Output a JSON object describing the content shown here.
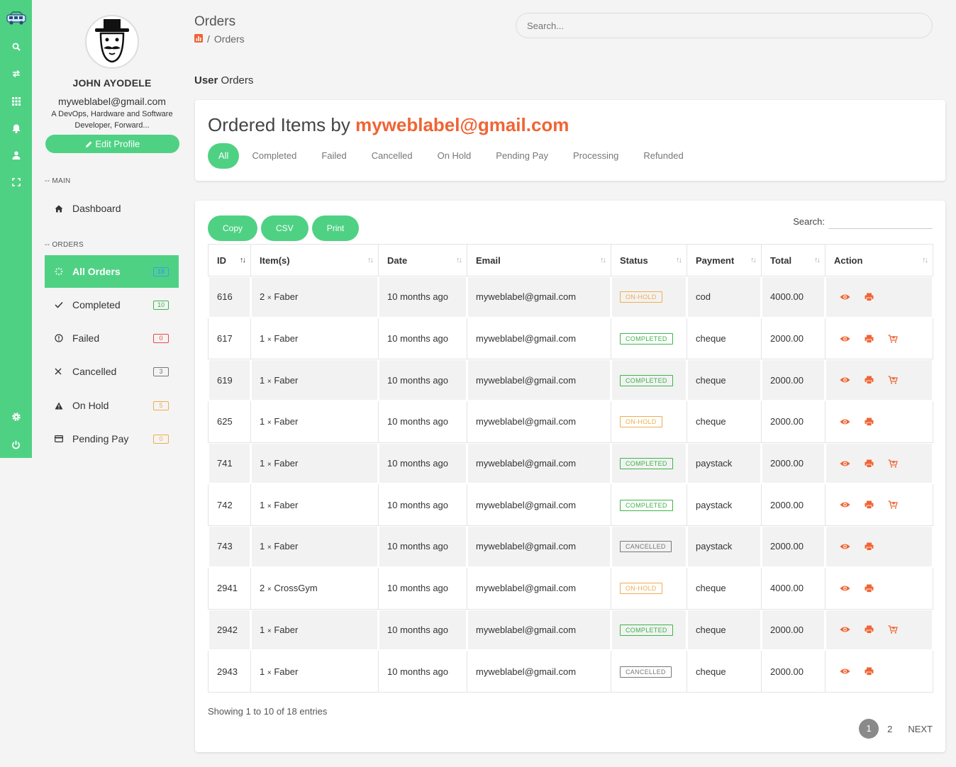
{
  "profile": {
    "name": "JOHN AYODELE",
    "email": "myweblabel@gmail.com",
    "bio": "A DevOps, Hardware and Software Developer, Forward...",
    "edit_label": "Edit Profile"
  },
  "sidebar": {
    "main_section": "-- MAIN",
    "orders_section": "-- ORDERS",
    "dashboard_label": "Dashboard",
    "items": [
      {
        "label": "All Orders",
        "count": "18",
        "color": "#3aa0e8"
      },
      {
        "label": "Completed",
        "count": "10",
        "color": "#3cb54a"
      },
      {
        "label": "Failed",
        "count": "0",
        "color": "#e84a4a"
      },
      {
        "label": "Cancelled",
        "count": "3",
        "color": "#777777"
      },
      {
        "label": "On Hold",
        "count": "5",
        "color": "#f0ad4e"
      },
      {
        "label": "Pending Pay",
        "count": "0",
        "color": "#f0ad4e"
      }
    ]
  },
  "header": {
    "title": "Orders",
    "breadcrumb_current": "Orders",
    "search_placeholder": "Search..."
  },
  "subheading": {
    "bold": "User",
    "rest": "Orders"
  },
  "filter_card": {
    "title_prefix": "Ordered Items by",
    "title_email": "myweblabel@gmail.com",
    "tabs": [
      "All",
      "Completed",
      "Failed",
      "Cancelled",
      "On Hold",
      "Pending Pay",
      "Processing",
      "Refunded"
    ]
  },
  "table_toolbar": {
    "buttons": [
      "Copy",
      "CSV",
      "Print"
    ],
    "search_label": "Search:"
  },
  "table": {
    "headers": [
      "ID",
      "Item(s)",
      "Date",
      "Email",
      "Status",
      "Payment",
      "Total",
      "Action"
    ],
    "rows": [
      {
        "id": "616",
        "qty": "2",
        "times": "×",
        "item": "Faber",
        "date": "10 months ago",
        "email": "myweblabel@gmail.com",
        "status": "ON-HOLD",
        "payment": "cod",
        "total": "4000.00"
      },
      {
        "id": "617",
        "qty": "1",
        "times": "×",
        "item": "Faber",
        "date": "10 months ago",
        "email": "myweblabel@gmail.com",
        "status": "COMPLETED",
        "payment": "cheque",
        "total": "2000.00"
      },
      {
        "id": "619",
        "qty": "1",
        "times": "×",
        "item": "Faber",
        "date": "10 months ago",
        "email": "myweblabel@gmail.com",
        "status": "COMPLETED",
        "payment": "cheque",
        "total": "2000.00"
      },
      {
        "id": "625",
        "qty": "1",
        "times": "×",
        "item": "Faber",
        "date": "10 months ago",
        "email": "myweblabel@gmail.com",
        "status": "ON-HOLD",
        "payment": "cheque",
        "total": "2000.00"
      },
      {
        "id": "741",
        "qty": "1",
        "times": "×",
        "item": "Faber",
        "date": "10 months ago",
        "email": "myweblabel@gmail.com",
        "status": "COMPLETED",
        "payment": "paystack",
        "total": "2000.00"
      },
      {
        "id": "742",
        "qty": "1",
        "times": "×",
        "item": "Faber",
        "date": "10 months ago",
        "email": "myweblabel@gmail.com",
        "status": "COMPLETED",
        "payment": "paystack",
        "total": "2000.00"
      },
      {
        "id": "743",
        "qty": "1",
        "times": "×",
        "item": "Faber",
        "date": "10 months ago",
        "email": "myweblabel@gmail.com",
        "status": "CANCELLED",
        "payment": "paystack",
        "total": "2000.00"
      },
      {
        "id": "2941",
        "qty": "2",
        "times": "×",
        "item": "CrossGym",
        "date": "10 months ago",
        "email": "myweblabel@gmail.com",
        "status": "ON-HOLD",
        "payment": "cheque",
        "total": "4000.00"
      },
      {
        "id": "2942",
        "qty": "1",
        "times": "×",
        "item": "Faber",
        "date": "10 months ago",
        "email": "myweblabel@gmail.com",
        "status": "COMPLETED",
        "payment": "cheque",
        "total": "2000.00"
      },
      {
        "id": "2943",
        "qty": "1",
        "times": "×",
        "item": "Faber",
        "date": "10 months ago",
        "email": "myweblabel@gmail.com",
        "status": "CANCELLED",
        "payment": "cheque",
        "total": "2000.00"
      }
    ]
  },
  "footer": {
    "info": "Showing 1 to 10 of 18 entries",
    "pages": [
      "1",
      "2"
    ],
    "next_label": "NEXT"
  },
  "colors": {
    "accent": "#4fd184",
    "highlight": "#f06434"
  }
}
